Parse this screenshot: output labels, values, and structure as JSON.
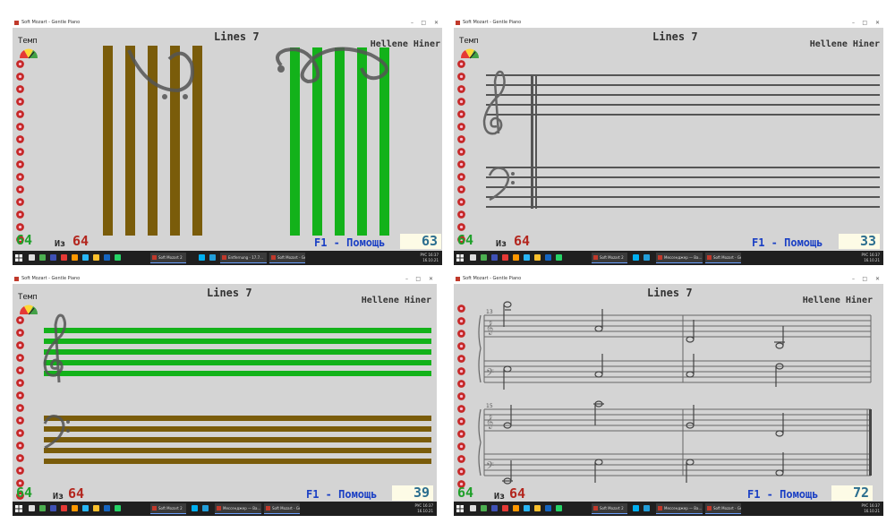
{
  "app": {
    "window_title": "Soft Mozart - Gentle Piano",
    "piece_title": "Lines 7",
    "author": "Hellene Hiner",
    "tempo_label": "Темп",
    "of_label": "Из",
    "total": "64",
    "help_label": "F1 - Помощь"
  },
  "panels": [
    {
      "level": "64",
      "counter": "63"
    },
    {
      "level": "64",
      "counter": "33"
    },
    {
      "level": "64",
      "counter": "39"
    },
    {
      "level": "64",
      "counter": "72"
    }
  ],
  "sheet": {
    "measure_top": "13",
    "measure_bottom": "15"
  },
  "taskbar": {
    "tasks": [
      "Soft Mozart 2",
      "Entfernung - 17.7...",
      "Soft Mozart - Gentl..."
    ],
    "short_tasks": [
      "Soft Mozart 2",
      "Мессенджер — Ва...",
      "Soft Mozart - Gentl..."
    ],
    "lang": "РУС",
    "time": "16:37",
    "date": "16.10.21"
  },
  "colors": {
    "brown": "#7a5c0a",
    "green": "#13b21a",
    "staff": "#555555",
    "flower": "#c62828"
  },
  "icons": [
    "tempo-gauge-icon",
    "flower-icon",
    "treble-clef-icon",
    "bass-clef-icon",
    "windows-start-icon"
  ]
}
